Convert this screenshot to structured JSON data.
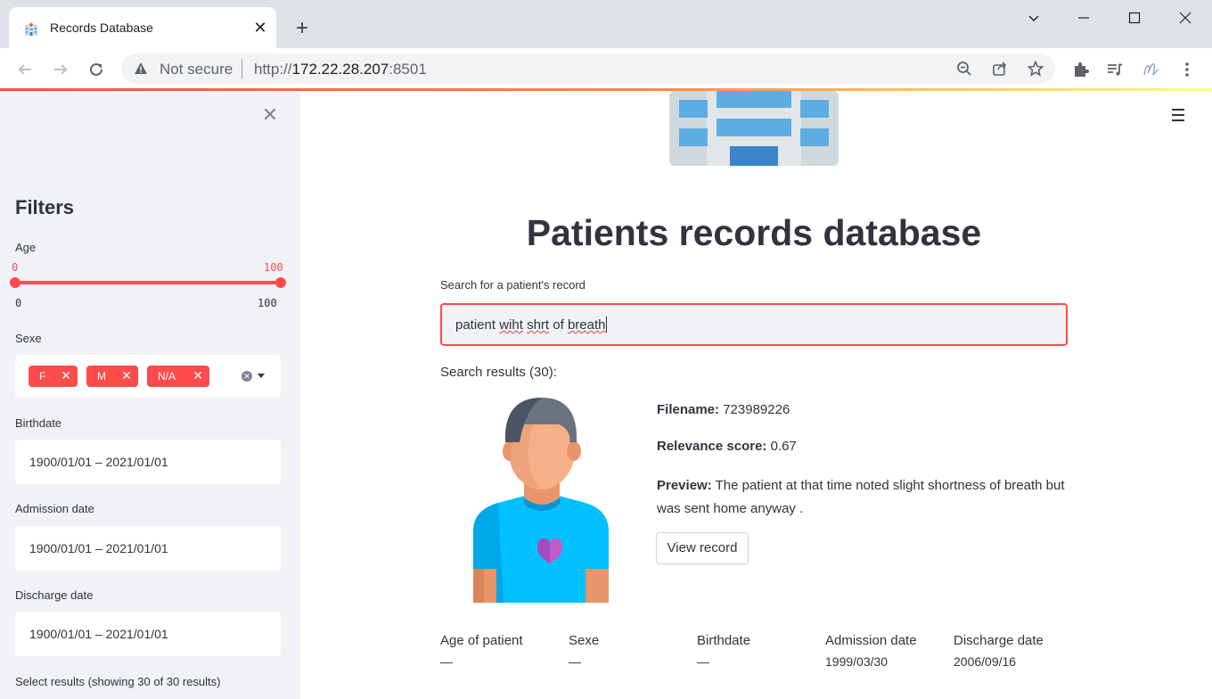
{
  "browser": {
    "tab_title": "Records Database",
    "not_secure": "Not secure",
    "url_prefix": "http://",
    "url_host": "172.22.28.207",
    "url_port": ":8501"
  },
  "sidebar": {
    "title": "Filters",
    "age": {
      "label": "Age",
      "min": "0",
      "max": "100",
      "range_min": "0",
      "range_max": "100"
    },
    "sexe": {
      "label": "Sexe",
      "chips": [
        "F",
        "M",
        "N/A"
      ]
    },
    "birthdate": {
      "label": "Birthdate",
      "value": "1900/01/01 – 2021/01/01"
    },
    "admission": {
      "label": "Admission date",
      "value": "1900/01/01 – 2021/01/01"
    },
    "discharge": {
      "label": "Discharge date",
      "value": "1900/01/01 – 2021/01/01"
    },
    "select_results": "Select results (showing 30 of 30 results)"
  },
  "main": {
    "title": "Patients records database",
    "search_label": "Search for a patient's record",
    "search_words": [
      "patient",
      "wiht",
      "shrt",
      "of",
      "breath"
    ],
    "results_label": "Search results (30):",
    "result": {
      "filename_label": "Filename:",
      "filename": "723989226",
      "relevance_label": "Relevance score:",
      "relevance": "0.67",
      "preview_label": "Preview:",
      "preview": "The patient at that time noted slight shortness of breath but was sent home anyway .",
      "view_button": "View record"
    },
    "details": [
      {
        "label": "Age of patient",
        "value": "—"
      },
      {
        "label": "Sexe",
        "value": "—"
      },
      {
        "label": "Birthdate",
        "value": "—"
      },
      {
        "label": "Admission date",
        "value": "1999/03/30"
      },
      {
        "label": "Discharge date",
        "value": "2006/09/16"
      }
    ]
  },
  "colors": {
    "accent": "#ff4b4b",
    "sidebar_bg": "#f0f2f6",
    "text": "#31333f"
  }
}
